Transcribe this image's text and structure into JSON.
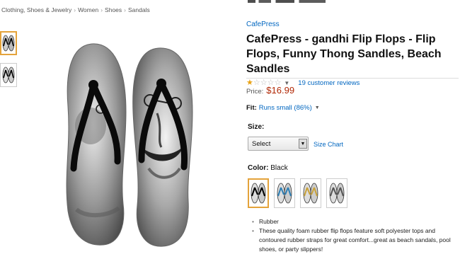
{
  "breadcrumb": [
    "Clothing, Shoes & Jewelry",
    "Women",
    "Shoes",
    "Sandals"
  ],
  "product": {
    "brand": "CafePress",
    "title": "CafePress - gandhi Flip Flops - Flip Flops, Funny Thong Sandles, Beach Sandles",
    "rating": 1,
    "rating_max": 5,
    "reviews_label": "19 customer reviews"
  },
  "price": {
    "label": "Price:",
    "value": "$16.99"
  },
  "fit": {
    "label": "Fit:",
    "value": "Runs small (86%)"
  },
  "size": {
    "label": "Size:",
    "selected": "Select",
    "chart_label": "Size Chart"
  },
  "color": {
    "label": "Color:",
    "selected": "Black"
  },
  "features": [
    "Rubber",
    "These quality foam rubber flip flops feature soft polyester tops and contoured rubber straps for great comfort...great as beach sandals, pool shoes, or party slippers!"
  ],
  "colors": {
    "link": "#0066c0",
    "price": "#b12704",
    "star": "#e8a113",
    "selection": "#e4a33b"
  }
}
